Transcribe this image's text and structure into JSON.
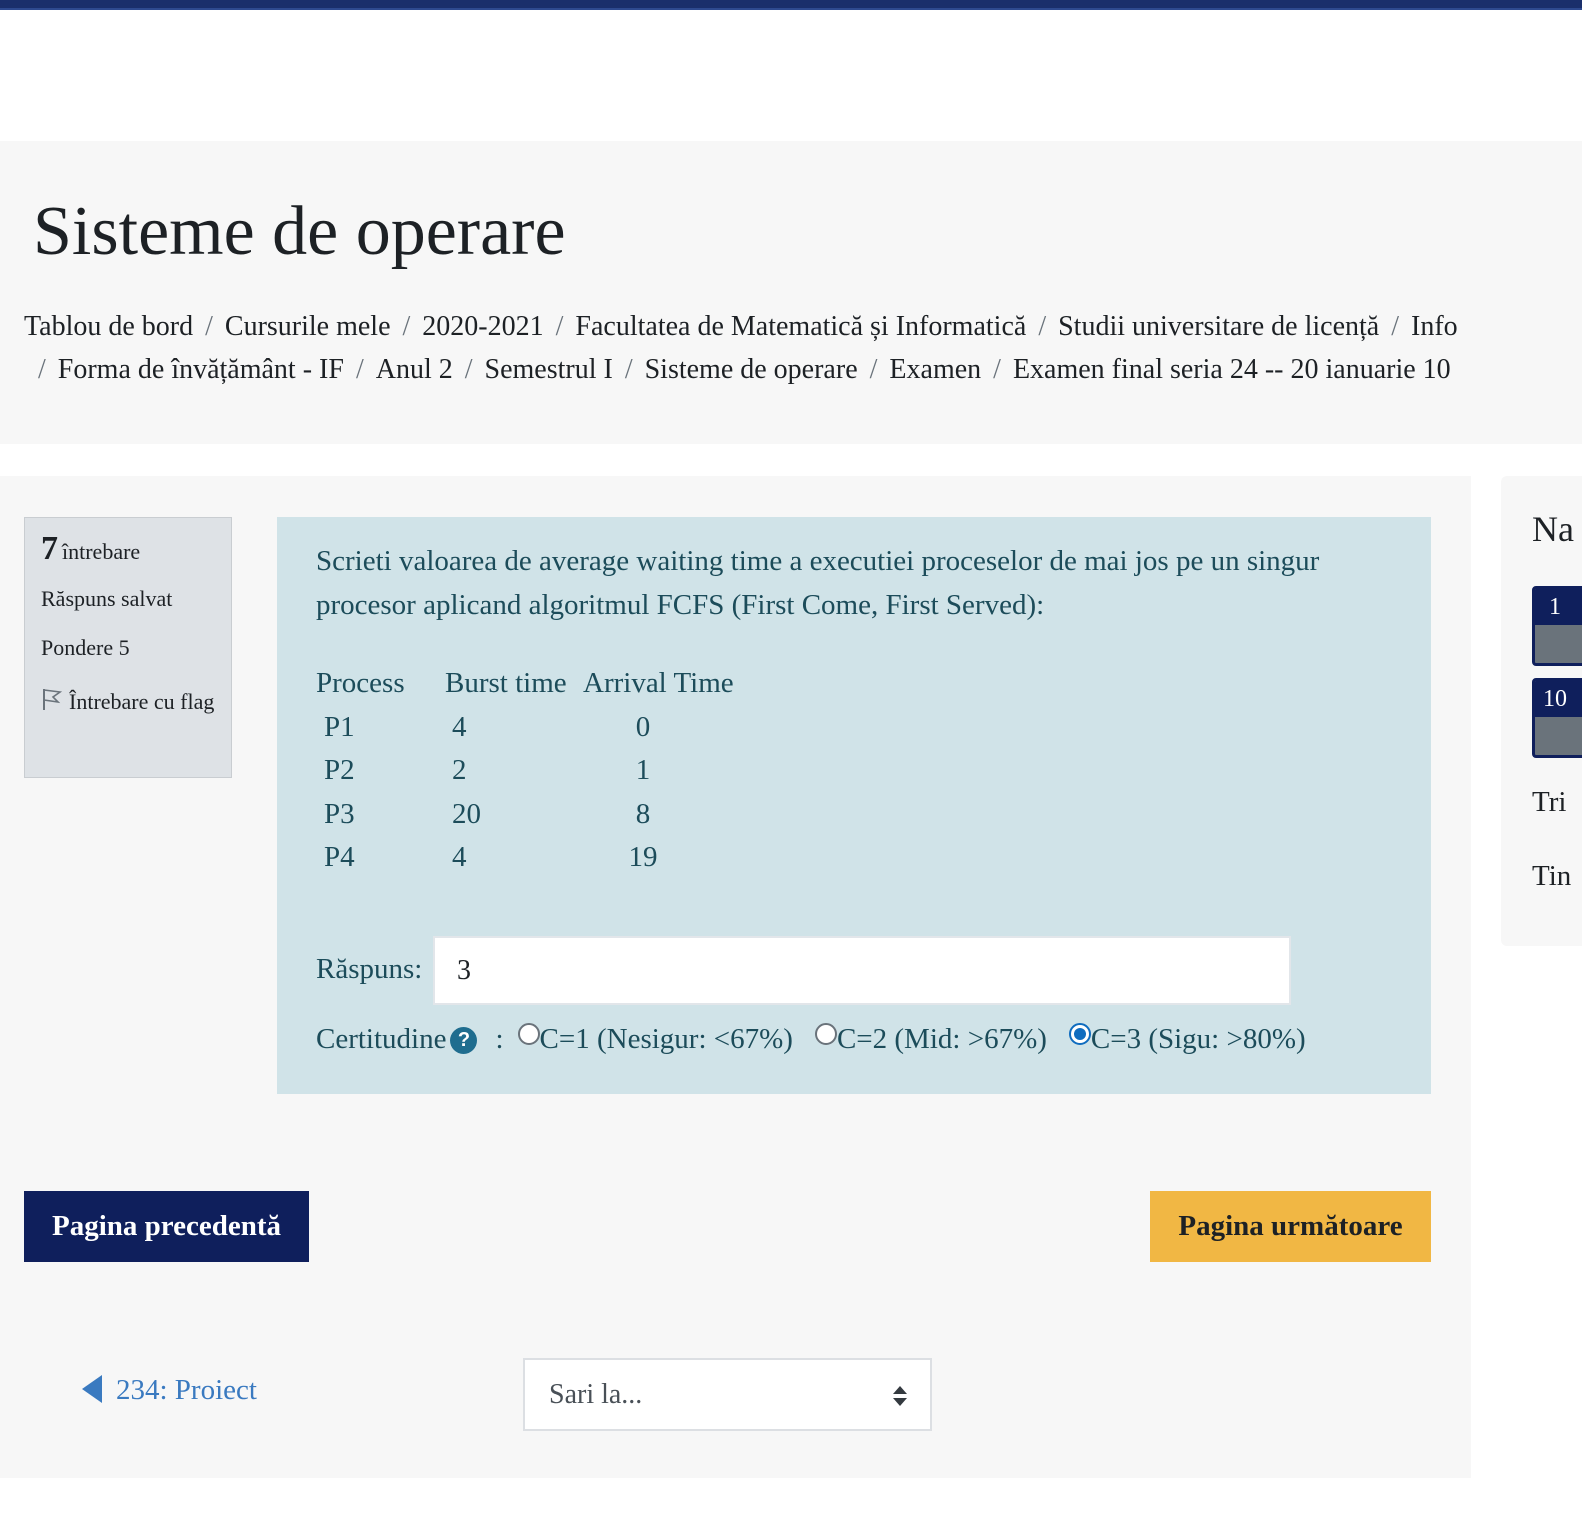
{
  "page_title": "Sisteme de operare",
  "breadcrumb_row1": [
    "Tablou de bord",
    "Cursurile mele",
    "2020-2021",
    "Facultatea de Matematică și Informatică",
    "Studii universitare de licență",
    "Info"
  ],
  "breadcrumb_row2": [
    "Forma de învățământ - IF",
    "Anul 2",
    "Semestrul I",
    "Sisteme de operare",
    "Examen",
    "Examen final seria 24 -- 20 ianuarie 10"
  ],
  "breadcrumb_separator": "/",
  "question_info": {
    "number": "7",
    "number_label": "întrebare",
    "state": "Răspuns salvat",
    "weight": "Pondere 5",
    "flag_label": "Întrebare cu flag"
  },
  "question": {
    "text": "Scrieti valoarea de average waiting time a executiei proceselor de mai jos pe un singur procesor aplicand algoritmul FCFS (First Come, First Served):",
    "table_headers": [
      "Process",
      "Burst time",
      "Arrival Time"
    ],
    "table_rows": [
      [
        "P1",
        "4",
        "0"
      ],
      [
        "P2",
        "2",
        "1"
      ],
      [
        "P3",
        "20",
        "8"
      ],
      [
        "P4",
        "4",
        "19"
      ]
    ],
    "answer_label": "Răspuns:",
    "answer_value": "3",
    "certainty_label": "Certitudine",
    "certainty_colon": ":",
    "certainty_options": [
      "C=1 (Nesigur: <67%)",
      "C=2 (Mid: >67%)",
      "C=3 (Sigu: >80%)"
    ],
    "certainty_selected": "C=3 (Sigu: >80%)"
  },
  "buttons": {
    "prev": "Pagina precedentă",
    "next": "Pagina următoare"
  },
  "activity_nav": {
    "prev_link": "234: Proiect",
    "jump_placeholder": "Sari la..."
  },
  "right_panel": {
    "title": "Na",
    "question_buttons": [
      "1",
      "10"
    ],
    "text1": "Tri",
    "text2": "Tin"
  },
  "colors": {
    "top_bar": "#1a2f6b",
    "question_bg": "#d0e3e8",
    "prev_button": "#0f1f5c",
    "next_button": "#f1b744",
    "link": "#3a7ac0"
  }
}
